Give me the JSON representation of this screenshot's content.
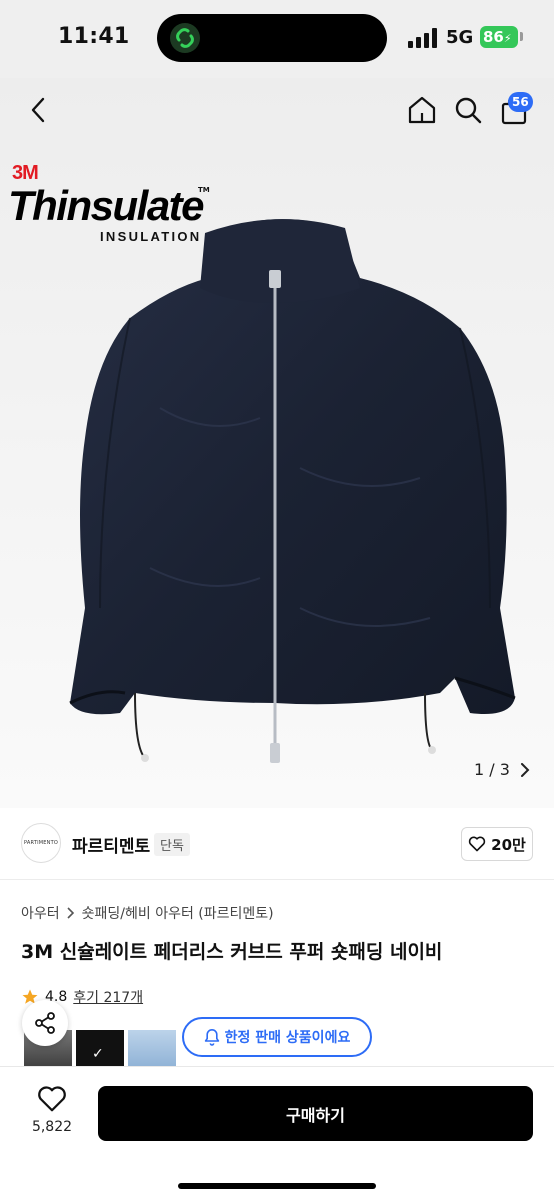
{
  "status_bar": {
    "time": "11:41",
    "network": "5G",
    "battery": "86"
  },
  "nav": {
    "cart_count": "56"
  },
  "hero": {
    "brand_3m": "3M",
    "brand_main": "Thinsulate",
    "brand_tm": "TM",
    "brand_sub": "INSULATION",
    "page_indicator": "1 / 3"
  },
  "seller": {
    "logo_text": "PARTIMENTO",
    "name": "파르티멘토",
    "tag": "단독",
    "likes": "20만"
  },
  "product": {
    "breadcrumb": [
      "아우터",
      "숏패딩/헤비 아우터 (파르티멘토)"
    ],
    "title": "3M 신슐레이트 페더리스 커브드 푸퍼 숏패딩 네이비",
    "rating": "4.8",
    "reviews": "후기 217개",
    "notice": "한정 판매 상품이에요"
  },
  "bottom": {
    "wish_count": "5,822",
    "buy_label": "구매하기"
  },
  "colors": {
    "accent": "#2d6cf6",
    "star": "#f5a623",
    "battery": "#34c759",
    "jacket": "#1b2233"
  }
}
